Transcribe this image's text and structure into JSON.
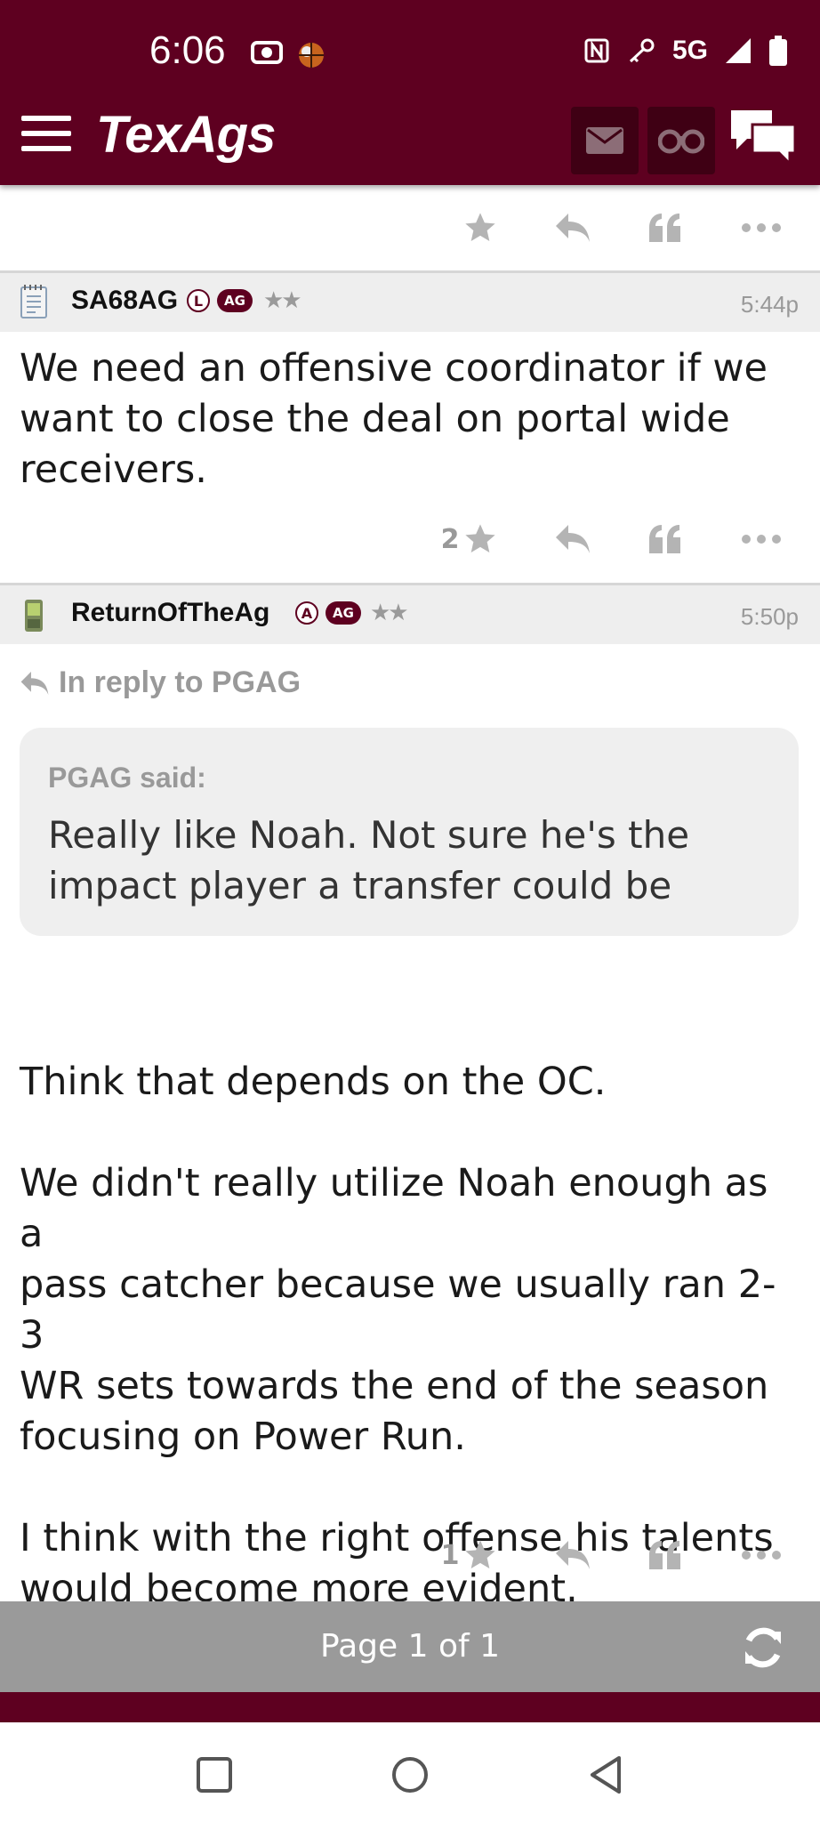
{
  "status": {
    "time": "6:06",
    "network": "5G"
  },
  "header": {
    "logo": "TexAgs"
  },
  "posts": [
    {
      "username": "SA68AG",
      "badge_letter": "L",
      "badge_group": "AG",
      "stars": "★★",
      "time": "5:44p",
      "body": [
        "We need an offensive coordinator if we",
        "want to close the deal on portal wide",
        "receivers."
      ],
      "rating": "2"
    },
    {
      "username": "ReturnOfTheAg",
      "badge_letter": "A",
      "badge_group": "AG",
      "stars": "★★",
      "time": "5:50p",
      "reply_to": "In reply to PGAG",
      "quote_said": "PGAG said:",
      "quote_lines": [
        "Really like Noah. Not sure he's the",
        "impact player a transfer could be"
      ],
      "body": [
        "Think that depends on the OC.",
        "We didn't really utilize Noah enough as a",
        "pass catcher because we usually ran 2-3",
        "WR sets towards the end of the season",
        "focusing on Power Run.",
        "I think with the right offense his talents",
        "would become more evident."
      ],
      "rating": "1"
    }
  ],
  "pager": {
    "label": "Page 1 of 1"
  },
  "colors": {
    "brand": "#5e0020",
    "muted": "#b4b4b4"
  }
}
